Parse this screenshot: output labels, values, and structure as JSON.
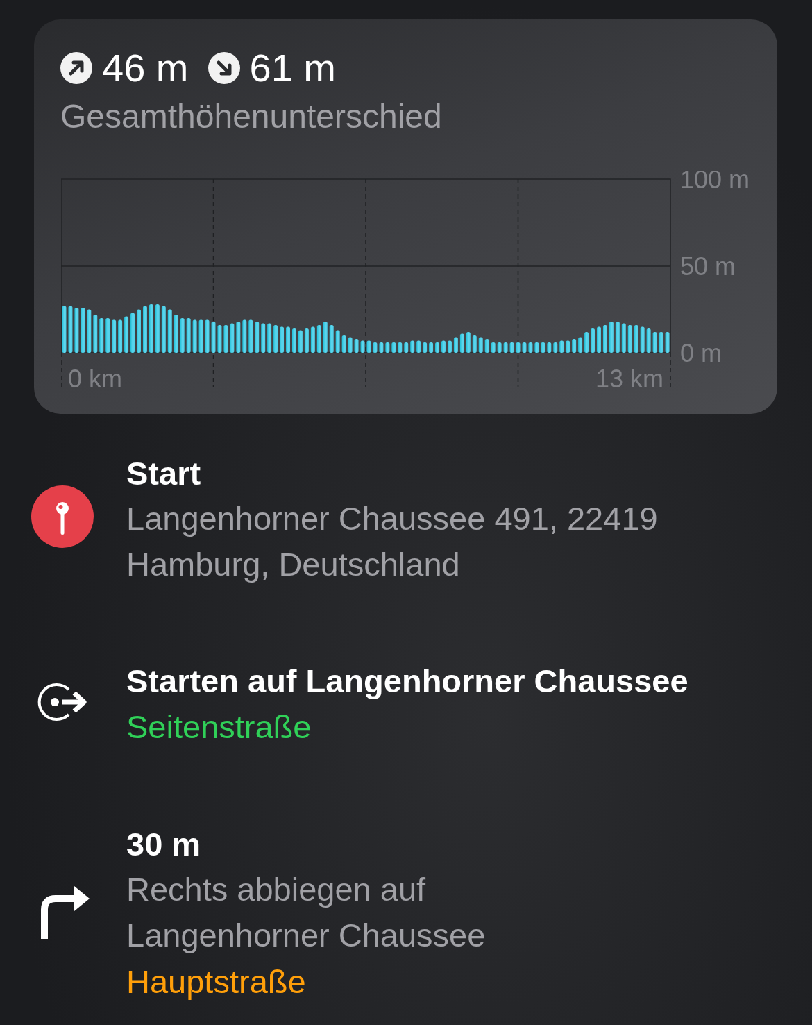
{
  "elevation": {
    "ascent": "46 m",
    "descent": "61 m",
    "caption": "Gesamthöhenunterschied",
    "distance_start": "0 km",
    "distance_end": "13 km",
    "chart_data": {
      "type": "bar",
      "ref_lines": [
        {
          "axis": "y",
          "value": 50
        }
      ],
      "ylim": [
        0,
        100
      ],
      "yticks": [
        {
          "value": 0,
          "label": "0 m"
        },
        {
          "value": 50,
          "label": "50 m"
        },
        {
          "value": 100,
          "label": "100 m"
        }
      ],
      "series": [
        {
          "color": "#4fd0e8",
          "values": [
            27,
            27,
            26,
            26,
            25,
            22,
            20,
            20,
            19,
            19,
            21,
            23,
            25,
            27,
            28,
            28,
            27,
            25,
            22,
            20,
            20,
            19,
            19,
            19,
            18,
            16,
            16,
            17,
            18,
            19,
            19,
            18,
            17,
            17,
            16,
            15,
            15,
            14,
            13,
            14,
            15,
            16,
            18,
            16,
            13,
            10,
            9,
            8,
            7,
            7,
            6,
            6,
            6,
            6,
            6,
            6,
            7,
            7,
            6,
            6,
            6,
            7,
            7,
            9,
            11,
            12,
            10,
            9,
            8,
            6,
            6,
            6,
            6,
            6,
            6,
            6,
            6,
            6,
            6,
            6,
            7,
            7,
            8,
            9,
            12,
            14,
            15,
            16,
            18,
            18,
            17,
            16,
            16,
            15,
            14,
            12,
            12,
            12
          ]
        }
      ]
    }
  },
  "steps": [
    {
      "kind": "start",
      "title": "Start",
      "detail": [
        "Langenhorner Chaussee 491, 22419",
        "Hamburg, Deutschland"
      ]
    },
    {
      "kind": "depart",
      "title": "Starten auf Langenhorner Chaussee",
      "road": "Seitenstraße",
      "color": "#30d158"
    },
    {
      "kind": "turn-right",
      "title": "30 m",
      "detail": [
        "Rechts abbiegen auf",
        "Langenhorner Chaussee"
      ],
      "road": "Hauptstraße",
      "color": "#ff9f0a"
    }
  ]
}
